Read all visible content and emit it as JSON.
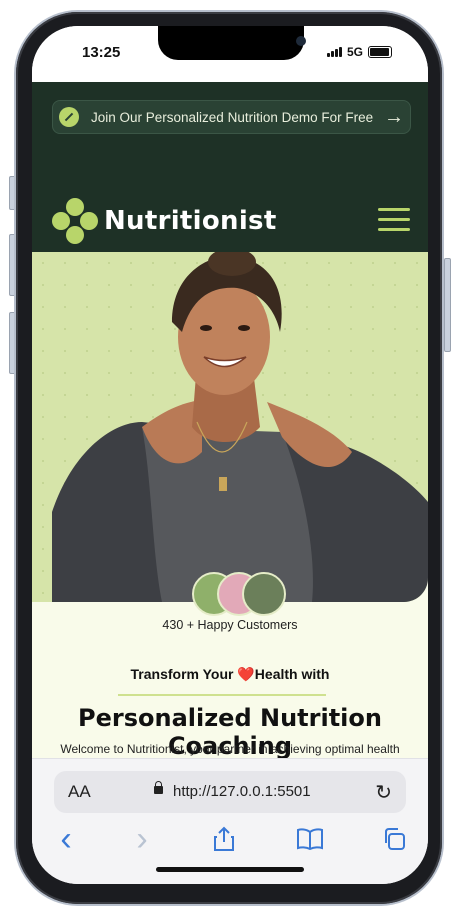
{
  "status_bar": {
    "time": "13:25",
    "network": "5G"
  },
  "promo": {
    "text": "Join Our Personalized Nutrition Demo For Free",
    "arrow": "→"
  },
  "header": {
    "brand": "Nutritionist"
  },
  "hero": {
    "customers_text": "430 + Happy Customers",
    "tagline_before": "Transform Your ",
    "tagline_heart": "❤️",
    "tagline_after": "Health with",
    "headline": "Personalized Nutrition Coaching",
    "welcome": "Welcome to Nutritionist, your partner in achieving optimal health"
  },
  "browser": {
    "text_size_label": "AA",
    "url": "http://127.0.0.1:5501",
    "reload_icon": "↻"
  },
  "toolbar": {
    "back_icon": "‹",
    "forward_icon": "›",
    "share_icon": "share-icon",
    "bookmarks_icon": "book-icon",
    "tabs_icon": "tabs-icon"
  },
  "colors": {
    "dark_green": "#1e3126",
    "lime": "#b8d56a",
    "hero_bg": "#d6e4a9",
    "page_bg": "#f9fbea",
    "safari_blue": "#3a79d6"
  }
}
